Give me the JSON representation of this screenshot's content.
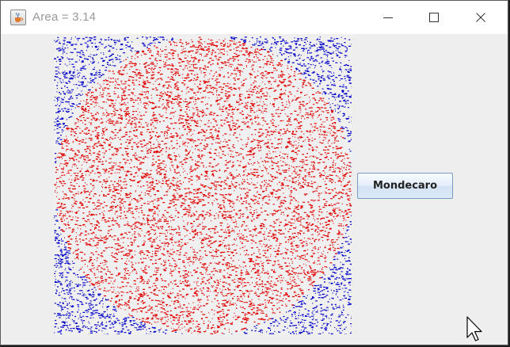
{
  "window": {
    "title": "Area = 3.14",
    "icon": "java-cup-icon",
    "controls": [
      "minimize-icon",
      "maximize-icon",
      "close-icon"
    ]
  },
  "canvas": {
    "description_free": true,
    "inside_color": "#e00000",
    "outside_color": "#0000c8",
    "background_color": "#f0f0f0"
  },
  "button": {
    "label": "Mondecaro"
  },
  "colors": {
    "titlebar_bg": "#ffffff",
    "title_text": "#999999",
    "window_bg": "#eeeeee"
  }
}
